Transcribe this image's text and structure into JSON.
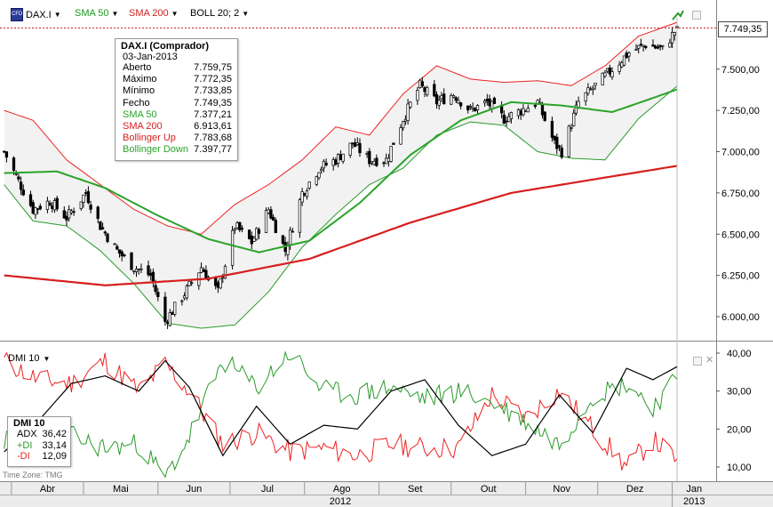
{
  "header": {
    "symbol": "DAX.I",
    "sma50_label": "SMA 50",
    "sma200_label": "SMA 200",
    "boll_label": "BOLL 20; 2",
    "caret": "▼"
  },
  "colors": {
    "candle_up": "#ffffff",
    "candle_down": "#000000",
    "sma50": "#2aa42a",
    "sma200": "#d81e1e",
    "boll_up": "#ee2222",
    "boll_down": "#2a9a2a",
    "boll_fill": "#f2f2f2",
    "price_line": "#cc2222",
    "adx": "#000000",
    "plus_di": "#2a9a2a",
    "minus_di": "#ee2222"
  },
  "tooltip": {
    "title": "DAX.I (Comprador)",
    "date": "03-Jan-2013",
    "rows": [
      {
        "label": "Aberto",
        "value": "7.759,75",
        "color": "#000000"
      },
      {
        "label": "Máximo",
        "value": "7.772,35",
        "color": "#000000"
      },
      {
        "label": "Mínimo",
        "value": "7.733,85",
        "color": "#000000"
      },
      {
        "label": "Fecho",
        "value": "7.749,35",
        "color": "#000000"
      },
      {
        "label": "SMA 50",
        "value": "7.377,21",
        "color": "#2aa42a"
      },
      {
        "label": "SMA 200",
        "value": "6.913,61",
        "color": "#d81e1e"
      },
      {
        "label": "Bollinger Up",
        "value": "7.783,68",
        "color": "#d81e1e"
      },
      {
        "label": "Bollinger Down",
        "value": "7.397,77",
        "color": "#2aa42a"
      }
    ]
  },
  "last_price": "7.749,35",
  "dmi": {
    "label": "DMI 10",
    "box_title": "DMI 10",
    "rows": [
      {
        "label": "ADX",
        "value": "36,42",
        "color": "#000000"
      },
      {
        "label": "+DI",
        "value": "33,14",
        "color": "#2a9a2a"
      },
      {
        "label": "-DI",
        "value": "12,09",
        "color": "#ee2222"
      }
    ]
  },
  "timezone": "Time Zone: TMG",
  "chart_data": [
    {
      "type": "candlestick",
      "title": "DAX.I",
      "y_ticks": [
        "6.000,00",
        "6.250,00",
        "6.500,00",
        "6.750,00",
        "7.000,00",
        "7.250,00",
        "7.500,00",
        "7.749,35"
      ],
      "y_tick_values": [
        6000,
        6250,
        6500,
        6750,
        7000,
        7250,
        7500
      ],
      "ylim": [
        5850,
        7830
      ],
      "last_close": 7749.35,
      "months": [
        "Abr",
        "Mai",
        "Jun",
        "Jul",
        "Ago",
        "Set",
        "Out",
        "Nov",
        "Dez",
        "Jan"
      ],
      "years": [
        "2012",
        "2013"
      ],
      "close_anchors": [
        {
          "date": "2012-03-29",
          "value": 7000
        },
        {
          "date": "2012-04-03",
          "value": 6850
        },
        {
          "date": "2012-04-10",
          "value": 6650
        },
        {
          "date": "2012-04-17",
          "value": 6700
        },
        {
          "date": "2012-04-24",
          "value": 6600
        },
        {
          "date": "2012-05-02",
          "value": 6750
        },
        {
          "date": "2012-05-08",
          "value": 6550
        },
        {
          "date": "2012-05-15",
          "value": 6400
        },
        {
          "date": "2012-05-22",
          "value": 6300
        },
        {
          "date": "2012-05-29",
          "value": 6250
        },
        {
          "date": "2012-06-04",
          "value": 5970
        },
        {
          "date": "2012-06-12",
          "value": 6140
        },
        {
          "date": "2012-06-19",
          "value": 6300
        },
        {
          "date": "2012-06-26",
          "value": 6150
        },
        {
          "date": "2012-07-03",
          "value": 6550
        },
        {
          "date": "2012-07-10",
          "value": 6450
        },
        {
          "date": "2012-07-17",
          "value": 6650
        },
        {
          "date": "2012-07-24",
          "value": 6400
        },
        {
          "date": "2012-07-31",
          "value": 6750
        },
        {
          "date": "2012-08-07",
          "value": 6900
        },
        {
          "date": "2012-08-14",
          "value": 6950
        },
        {
          "date": "2012-08-21",
          "value": 7050
        },
        {
          "date": "2012-08-28",
          "value": 6950
        },
        {
          "date": "2012-09-04",
          "value": 6950
        },
        {
          "date": "2012-09-11",
          "value": 7200
        },
        {
          "date": "2012-09-18",
          "value": 7400
        },
        {
          "date": "2012-09-25",
          "value": 7300
        },
        {
          "date": "2012-10-02",
          "value": 7350
        },
        {
          "date": "2012-10-09",
          "value": 7250
        },
        {
          "date": "2012-10-16",
          "value": 7300
        },
        {
          "date": "2012-10-23",
          "value": 7200
        },
        {
          "date": "2012-10-30",
          "value": 7250
        },
        {
          "date": "2012-11-06",
          "value": 7300
        },
        {
          "date": "2012-11-13",
          "value": 7050
        },
        {
          "date": "2012-11-16",
          "value": 7000
        },
        {
          "date": "2012-11-23",
          "value": 7300
        },
        {
          "date": "2012-11-30",
          "value": 7400
        },
        {
          "date": "2012-12-07",
          "value": 7500
        },
        {
          "date": "2012-12-14",
          "value": 7600
        },
        {
          "date": "2012-12-21",
          "value": 7650
        },
        {
          "date": "2012-12-28",
          "value": 7620
        },
        {
          "date": "2013-01-03",
          "value": 7749.35
        }
      ],
      "sma50_anchors": [
        {
          "date": "2012-03-29",
          "value": 6870
        },
        {
          "date": "2012-04-20",
          "value": 6880
        },
        {
          "date": "2012-05-10",
          "value": 6780
        },
        {
          "date": "2012-05-31",
          "value": 6620
        },
        {
          "date": "2012-06-22",
          "value": 6470
        },
        {
          "date": "2012-07-13",
          "value": 6390
        },
        {
          "date": "2012-08-03",
          "value": 6460
        },
        {
          "date": "2012-08-24",
          "value": 6690
        },
        {
          "date": "2012-09-14",
          "value": 6980
        },
        {
          "date": "2012-10-05",
          "value": 7190
        },
        {
          "date": "2012-10-26",
          "value": 7300
        },
        {
          "date": "2012-11-16",
          "value": 7280
        },
        {
          "date": "2012-12-07",
          "value": 7240
        },
        {
          "date": "2012-12-21",
          "value": 7310
        },
        {
          "date": "2013-01-03",
          "value": 7377.21
        }
      ],
      "sma200_anchors": [
        {
          "date": "2012-03-29",
          "value": 6250
        },
        {
          "date": "2012-05-10",
          "value": 6190
        },
        {
          "date": "2012-06-22",
          "value": 6230
        },
        {
          "date": "2012-08-03",
          "value": 6350
        },
        {
          "date": "2012-09-14",
          "value": 6570
        },
        {
          "date": "2012-10-26",
          "value": 6750
        },
        {
          "date": "2012-12-07",
          "value": 6850
        },
        {
          "date": "2013-01-03",
          "value": 6913.61
        }
      ],
      "boll_up_anchors": [
        {
          "date": "2012-03-29",
          "value": 7250
        },
        {
          "date": "2012-04-10",
          "value": 7190
        },
        {
          "date": "2012-04-24",
          "value": 6950
        },
        {
          "date": "2012-05-08",
          "value": 6800
        },
        {
          "date": "2012-05-22",
          "value": 6650
        },
        {
          "date": "2012-06-05",
          "value": 6550
        },
        {
          "date": "2012-06-19",
          "value": 6500
        },
        {
          "date": "2012-07-03",
          "value": 6680
        },
        {
          "date": "2012-07-17",
          "value": 6800
        },
        {
          "date": "2012-07-31",
          "value": 6950
        },
        {
          "date": "2012-08-14",
          "value": 7150
        },
        {
          "date": "2012-08-28",
          "value": 7100
        },
        {
          "date": "2012-09-11",
          "value": 7350
        },
        {
          "date": "2012-09-25",
          "value": 7520
        },
        {
          "date": "2012-10-09",
          "value": 7440
        },
        {
          "date": "2012-10-23",
          "value": 7420
        },
        {
          "date": "2012-11-06",
          "value": 7430
        },
        {
          "date": "2012-11-20",
          "value": 7400
        },
        {
          "date": "2012-12-04",
          "value": 7520
        },
        {
          "date": "2012-12-18",
          "value": 7700
        },
        {
          "date": "2013-01-03",
          "value": 7783.68
        }
      ],
      "boll_down_anchors": [
        {
          "date": "2012-03-29",
          "value": 6800
        },
        {
          "date": "2012-04-10",
          "value": 6580
        },
        {
          "date": "2012-04-24",
          "value": 6550
        },
        {
          "date": "2012-05-08",
          "value": 6400
        },
        {
          "date": "2012-05-22",
          "value": 6200
        },
        {
          "date": "2012-06-05",
          "value": 5960
        },
        {
          "date": "2012-06-19",
          "value": 5930
        },
        {
          "date": "2012-07-03",
          "value": 5950
        },
        {
          "date": "2012-07-17",
          "value": 6150
        },
        {
          "date": "2012-07-31",
          "value": 6420
        },
        {
          "date": "2012-08-14",
          "value": 6620
        },
        {
          "date": "2012-08-28",
          "value": 6800
        },
        {
          "date": "2012-09-11",
          "value": 6900
        },
        {
          "date": "2012-09-25",
          "value": 7100
        },
        {
          "date": "2012-10-09",
          "value": 7180
        },
        {
          "date": "2012-10-23",
          "value": 7160
        },
        {
          "date": "2012-11-06",
          "value": 7000
        },
        {
          "date": "2012-11-20",
          "value": 6960
        },
        {
          "date": "2012-12-04",
          "value": 6950
        },
        {
          "date": "2012-12-18",
          "value": 7200
        },
        {
          "date": "2013-01-03",
          "value": 7397.77
        }
      ]
    },
    {
      "type": "line",
      "title": "DMI 10",
      "y_ticks": [
        "10,00",
        "20,00",
        "30,00",
        "40,00"
      ],
      "y_tick_values": [
        10,
        20,
        30,
        40
      ],
      "ylim": [
        6,
        41
      ],
      "adx_anchors": [
        {
          "date": "2012-03-29",
          "value": 14
        },
        {
          "date": "2012-04-12",
          "value": 22
        },
        {
          "date": "2012-04-26",
          "value": 32
        },
        {
          "date": "2012-05-10",
          "value": 34
        },
        {
          "date": "2012-05-24",
          "value": 30
        },
        {
          "date": "2012-06-04",
          "value": 38
        },
        {
          "date": "2012-06-14",
          "value": 31
        },
        {
          "date": "2012-06-28",
          "value": 13
        },
        {
          "date": "2012-07-12",
          "value": 26
        },
        {
          "date": "2012-07-26",
          "value": 16
        },
        {
          "date": "2012-08-09",
          "value": 21
        },
        {
          "date": "2012-08-23",
          "value": 20
        },
        {
          "date": "2012-09-06",
          "value": 30
        },
        {
          "date": "2012-09-20",
          "value": 33
        },
        {
          "date": "2012-10-04",
          "value": 21
        },
        {
          "date": "2012-10-18",
          "value": 13
        },
        {
          "date": "2012-11-01",
          "value": 16
        },
        {
          "date": "2012-11-15",
          "value": 29
        },
        {
          "date": "2012-11-29",
          "value": 19
        },
        {
          "date": "2012-12-13",
          "value": 36
        },
        {
          "date": "2012-12-24",
          "value": 33
        },
        {
          "date": "2013-01-03",
          "value": 36.42
        }
      ],
      "plus_di_anchors": [
        {
          "date": "2012-03-29",
          "value": 17
        },
        {
          "date": "2012-04-12",
          "value": 14
        },
        {
          "date": "2012-04-26",
          "value": 18
        },
        {
          "date": "2012-05-10",
          "value": 15
        },
        {
          "date": "2012-05-24",
          "value": 16
        },
        {
          "date": "2012-06-04",
          "value": 7
        },
        {
          "date": "2012-06-14",
          "value": 18
        },
        {
          "date": "2012-06-28",
          "value": 38
        },
        {
          "date": "2012-07-12",
          "value": 31
        },
        {
          "date": "2012-07-26",
          "value": 40
        },
        {
          "date": "2012-08-09",
          "value": 30
        },
        {
          "date": "2012-08-23",
          "value": 29
        },
        {
          "date": "2012-09-06",
          "value": 31
        },
        {
          "date": "2012-09-20",
          "value": 28
        },
        {
          "date": "2012-10-04",
          "value": 30
        },
        {
          "date": "2012-10-18",
          "value": 27
        },
        {
          "date": "2012-11-01",
          "value": 22
        },
        {
          "date": "2012-11-15",
          "value": 16
        },
        {
          "date": "2012-11-29",
          "value": 29
        },
        {
          "date": "2012-12-13",
          "value": 32
        },
        {
          "date": "2012-12-24",
          "value": 26
        },
        {
          "date": "2013-01-03",
          "value": 33.14
        }
      ],
      "minus_di_anchors": [
        {
          "date": "2012-03-29",
          "value": 38
        },
        {
          "date": "2012-04-12",
          "value": 33
        },
        {
          "date": "2012-04-26",
          "value": 32
        },
        {
          "date": "2012-05-10",
          "value": 38
        },
        {
          "date": "2012-05-24",
          "value": 30
        },
        {
          "date": "2012-06-04",
          "value": 37
        },
        {
          "date": "2012-06-14",
          "value": 30
        },
        {
          "date": "2012-06-28",
          "value": 16
        },
        {
          "date": "2012-07-12",
          "value": 19
        },
        {
          "date": "2012-07-26",
          "value": 14
        },
        {
          "date": "2012-08-09",
          "value": 15
        },
        {
          "date": "2012-08-23",
          "value": 13
        },
        {
          "date": "2012-09-06",
          "value": 16
        },
        {
          "date": "2012-09-20",
          "value": 15
        },
        {
          "date": "2012-10-04",
          "value": 15
        },
        {
          "date": "2012-10-18",
          "value": 29
        },
        {
          "date": "2012-11-01",
          "value": 23
        },
        {
          "date": "2012-11-15",
          "value": 30
        },
        {
          "date": "2012-11-29",
          "value": 20
        },
        {
          "date": "2012-12-13",
          "value": 10
        },
        {
          "date": "2012-12-24",
          "value": 17
        },
        {
          "date": "2013-01-03",
          "value": 12.09
        }
      ]
    }
  ]
}
